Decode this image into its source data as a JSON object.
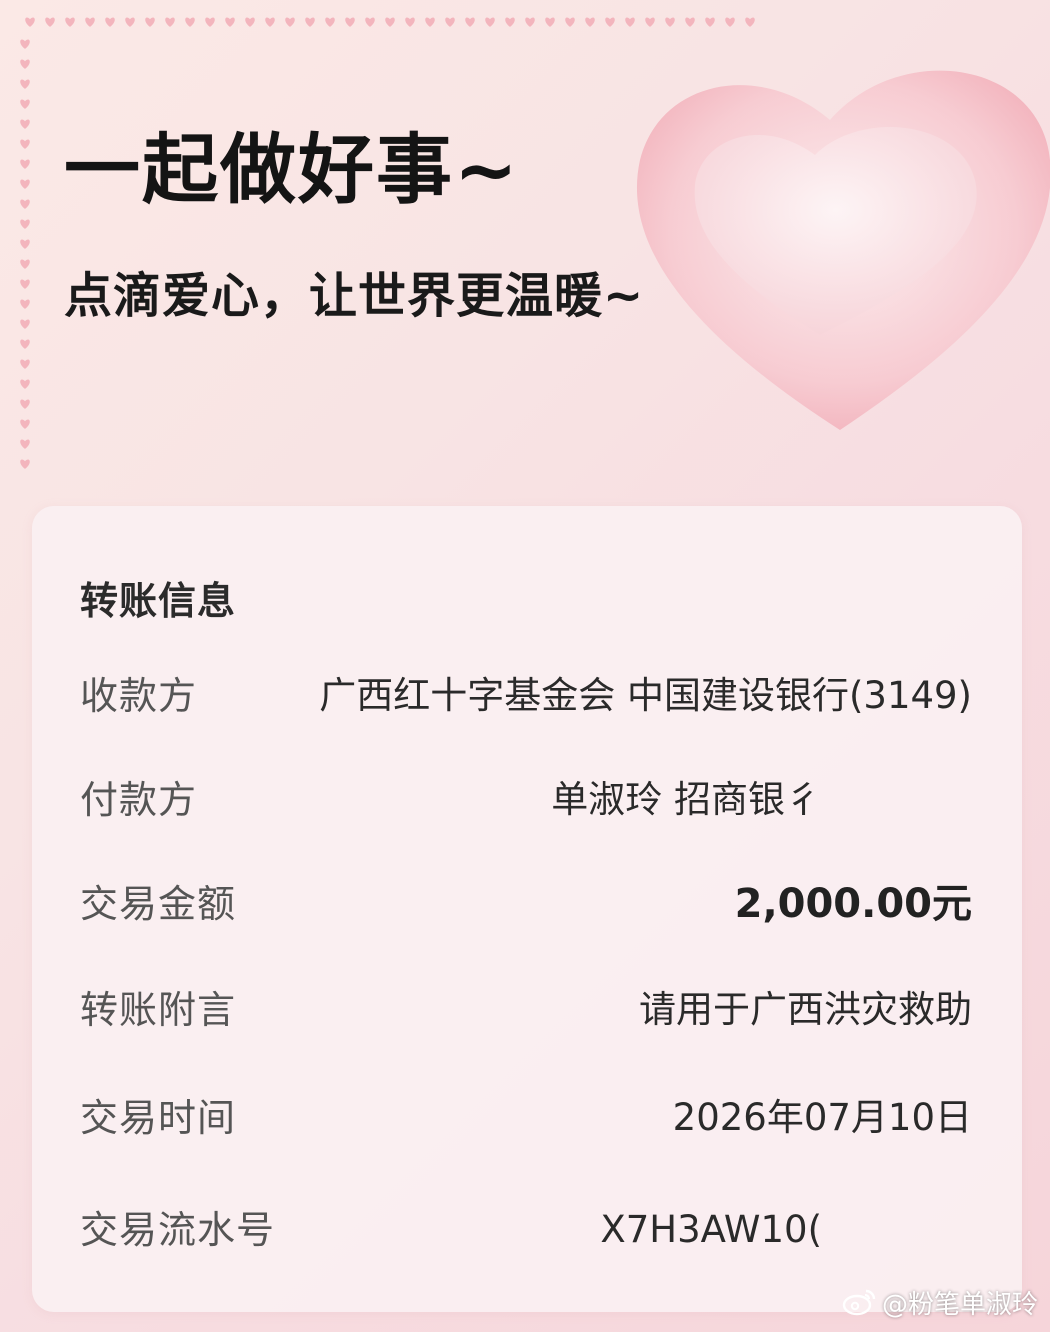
{
  "hero": {
    "title": "一起做好事~",
    "subtitle": "点滴爱心，让世界更温暖~"
  },
  "card": {
    "title": "转账信息",
    "rows": [
      {
        "label": "收款方",
        "value": "广西红十字基金会 中国建设银行(3149)"
      },
      {
        "label": "付款方",
        "value": "单淑玲 招商银彳"
      },
      {
        "label": "交易金额",
        "value": "2,000.00元"
      },
      {
        "label": "转账附言",
        "value": "请用于广西洪灾救助"
      },
      {
        "label": "交易时间",
        "value": "2026年07月10日"
      },
      {
        "label": "交易流水号",
        "value": "X7H3AW10("
      }
    ]
  },
  "watermark": {
    "text": "@粉笔单淑玲",
    "icon": "weibo-icon"
  },
  "colors": {
    "heart": "#f4b6bf",
    "heart_light": "#fbe3e6",
    "border_hearts": "#f2a7b0"
  }
}
